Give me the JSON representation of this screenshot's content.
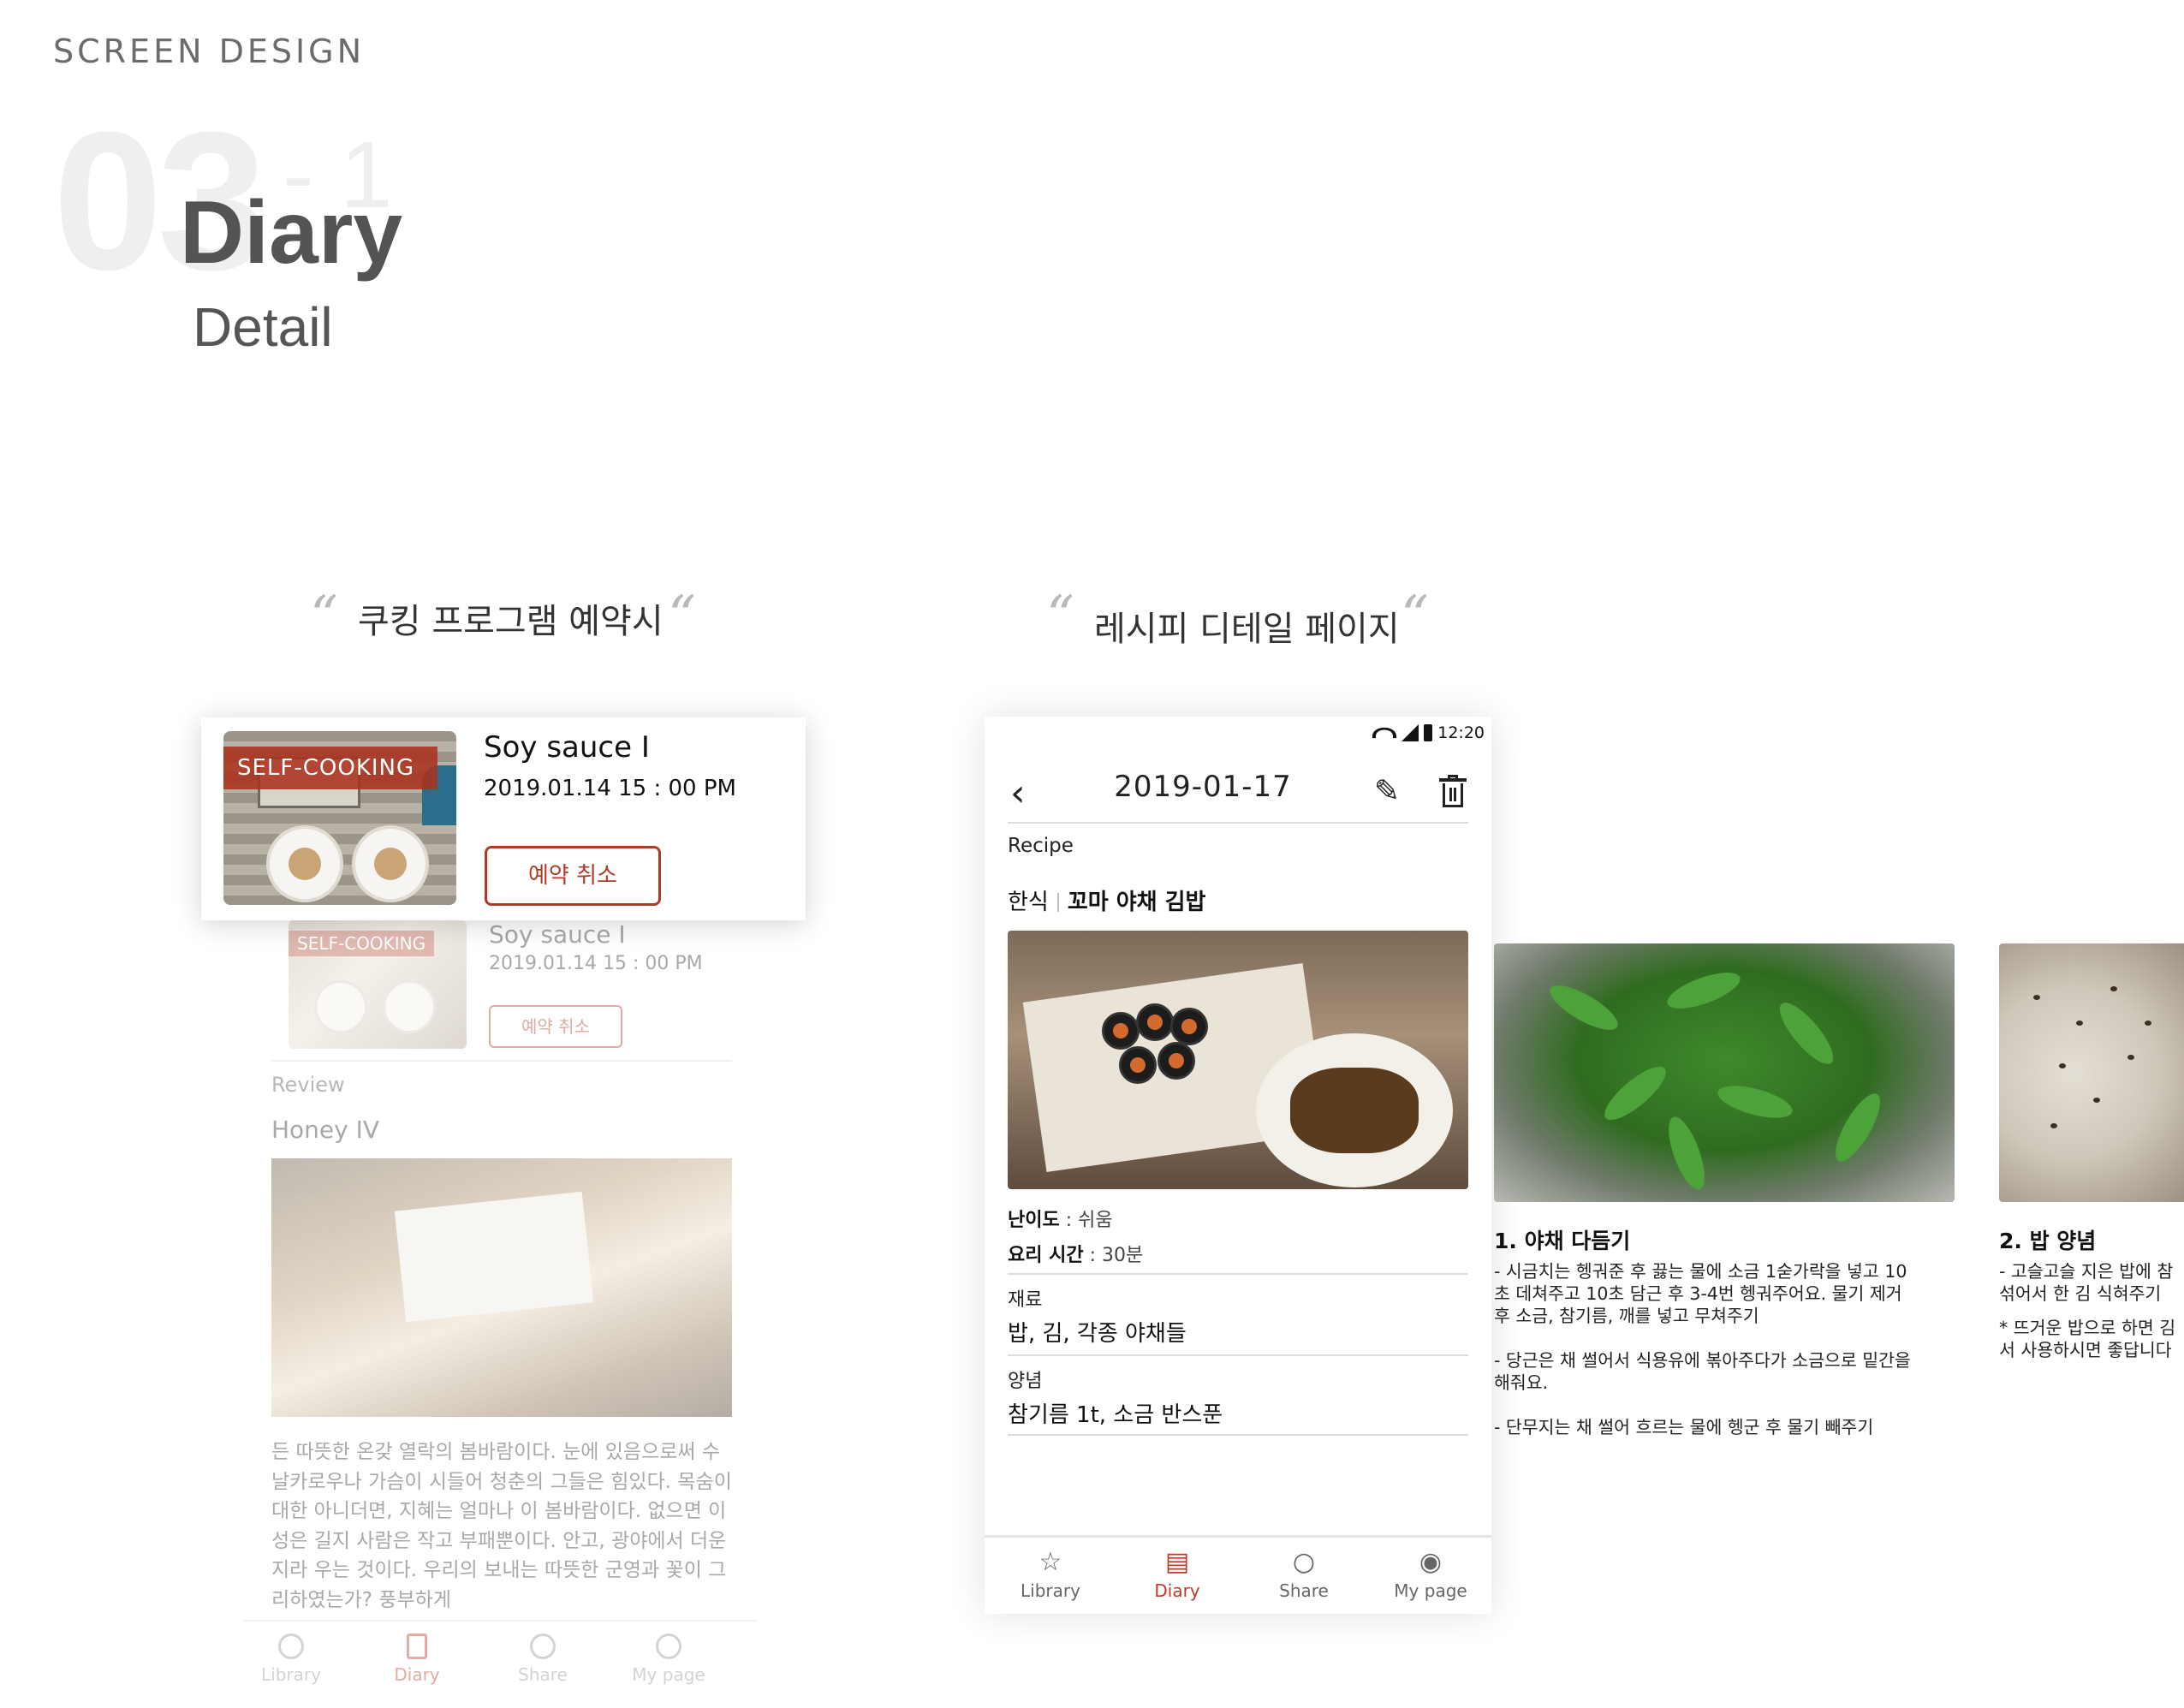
{
  "header": {
    "label": "SCREEN DESIGN",
    "number": "03",
    "sub_number": "- 1",
    "title": "Diary",
    "subtitle": "Detail"
  },
  "captions": {
    "left": "쿠킹 프로그램 예약시",
    "right": "레시피 디테일 페이지",
    "open_quote": "“",
    "close_quote": "“"
  },
  "reservation": {
    "badge": "SELF-COOKING",
    "title": "Soy sauce I",
    "date": "2019.01.14   15 : 00 PM",
    "cancel_button": "예약 취소"
  },
  "faded_screen": {
    "badge": "SELF-COOKING",
    "title": "Soy sauce I",
    "date": "2019.01.14   15 : 00 PM",
    "cancel_button": "예약 취소",
    "review_label": "Review",
    "review_title": "Honey IV",
    "review_text": "든 따뜻한 온갖 열락의 봄바람이다. 눈에 있음으로써 수 날카로우나 가슴이 시들어 청춘의 그들은 힘있다. 목숨이 대한 아니더면, 지혜는 얼마나 이 봄바람이다. 없으면 이성은 길지 사람은 작고 부패뿐이다. 안고, 광야에서 더운지라 우는 것이다. 우리의 보내는 따뜻한 군영과 꽃이 그리하였는가? 풍부하게",
    "nav": [
      "Library",
      "Diary",
      "Share",
      "My page"
    ]
  },
  "phone": {
    "status_time": "12:20",
    "date": "2019-01-17",
    "recipe_label": "Recipe",
    "category": "한식",
    "dish_name": "꼬마 야채 김밥",
    "difficulty_label": "난이도",
    "difficulty_value": "쉬움",
    "time_label": "요리 시간",
    "time_value": "30분",
    "ingredients_label": "재료",
    "ingredients_value": "밥, 김, 각종 야채들",
    "seasoning_label": "양념",
    "seasoning_value": "참기름 1t, 소금 반스푼",
    "tabs": [
      "Library",
      "Diary",
      "Share",
      "My page"
    ],
    "active_tab": "Diary"
  },
  "steps": [
    {
      "title": "1. 야채 다듬기",
      "lines": [
        "- 시금치는 헹궈준 후 끓는 물에 소금 1숟가락을 넣고  10",
        "초 데쳐주고 10초 담근 후 3-4번 헹궈주어요. 물기 제거",
        "후 소금, 참기름, 깨를 넣고 무쳐주기",
        "- 당근은 채 썰어서 식용유에 볶아주다가 소금으로 밑간을",
        "해줘요.",
        "- 단무지는 채 썰어 흐르는 물에 헹군 후 물기 빼주기"
      ]
    },
    {
      "title": "2. 밥 양념",
      "lines": [
        "- 고슬고슬 지은 밥에 참",
        "섞어서 한 김 식혀주기",
        "* 뜨거운 밥으로 하면 김",
        "서 사용하시면 좋답니다"
      ]
    }
  ],
  "colors": {
    "accent": "#c0392b",
    "badge": "#aa321e",
    "text": "#222222"
  }
}
